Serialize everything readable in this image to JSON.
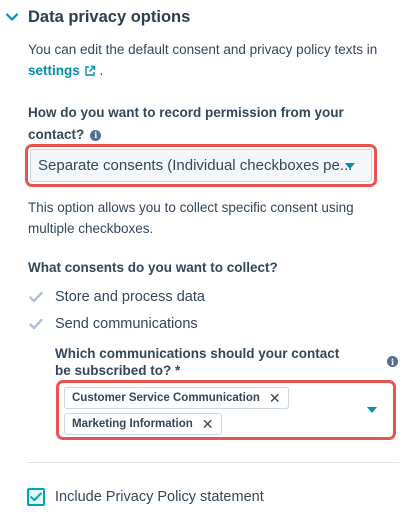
{
  "section": {
    "title": "Data privacy options",
    "description_prefix": "You can edit the default consent and privacy policy texts in",
    "settings_link": "settings",
    "description_suffix": "."
  },
  "permission": {
    "question": "How do you want to record permission from your contact?",
    "selected_option": "Separate consents (Individual checkboxes pe...",
    "help_text": "This option allows you to collect specific consent using multiple checkboxes."
  },
  "consents": {
    "question": "What consents do you want to collect?",
    "items": [
      {
        "label": "Store and process data",
        "checked": true,
        "disabled": true
      },
      {
        "label": "Send communications",
        "checked": true,
        "disabled": true
      }
    ]
  },
  "subscriptions": {
    "question": "Which communications should your contact be subscribed to? *",
    "tags": [
      {
        "label": "Customer Service Communication"
      },
      {
        "label": "Marketing Information"
      }
    ]
  },
  "privacy_policy": {
    "label": "Include Privacy Policy statement",
    "checked": true
  },
  "icons": {
    "section_toggle": "chevron-down-icon",
    "external_link": "external-link-icon",
    "info": "info-icon",
    "dropdown": "caret-down-icon",
    "remove": "close-icon",
    "check": "checkmark-icon"
  },
  "colors": {
    "accent": "#0091ae",
    "highlight": "#e8544e",
    "text": "#33475b",
    "checkbox_active": "#00a4bd"
  }
}
